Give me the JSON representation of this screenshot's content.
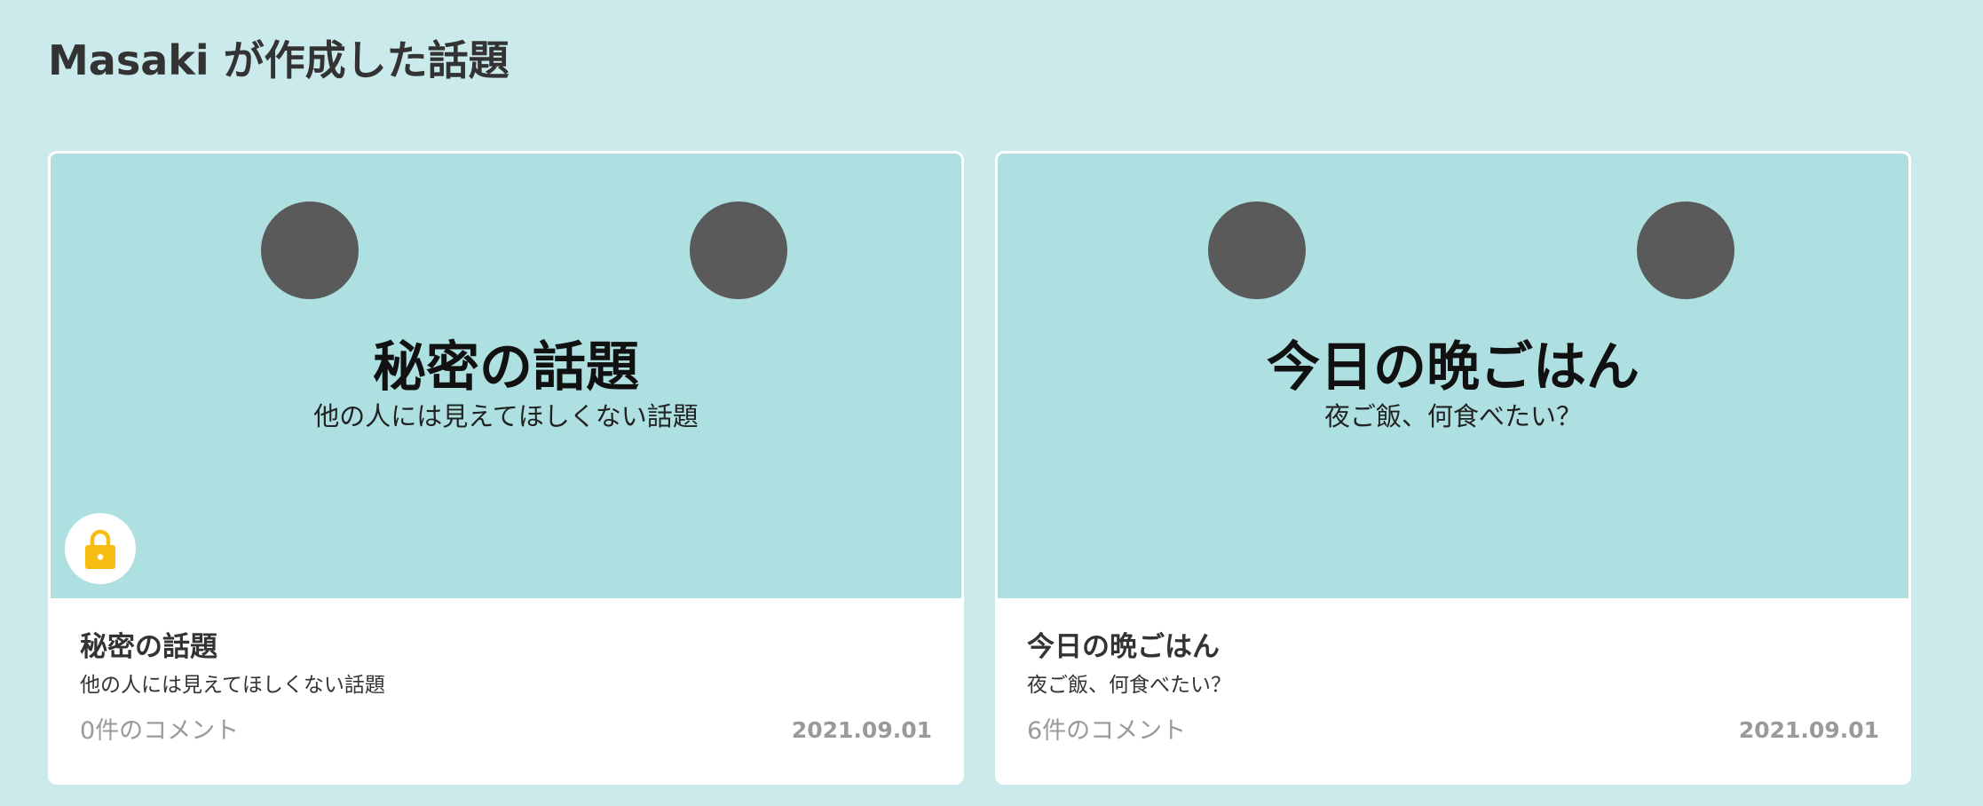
{
  "header": {
    "title": "Masaki が作成した話題"
  },
  "colors": {
    "background": "#cbeaec",
    "thumbnail": "#aee0e1",
    "eye": "#5a5a5a",
    "lock": "#f7bd12",
    "muted_text": "#9a9a9a"
  },
  "topics": [
    {
      "thumb_title": "秘密の話題",
      "thumb_subtitle": "他の人には見えてほしくない話題",
      "title": "秘密の話題",
      "description": "他の人には見えてほしくない話題",
      "comments": "0件のコメント",
      "date": "2021.09.01",
      "locked": true,
      "badge_icon": "lock-icon"
    },
    {
      "thumb_title": "今日の晩ごはん",
      "thumb_subtitle": "夜ご飯、何食べたい？",
      "title": "今日の晩ごはん",
      "description": "夜ご飯、何食べたい？",
      "comments": "6件のコメント",
      "date": "2021.09.01",
      "locked": false
    }
  ]
}
